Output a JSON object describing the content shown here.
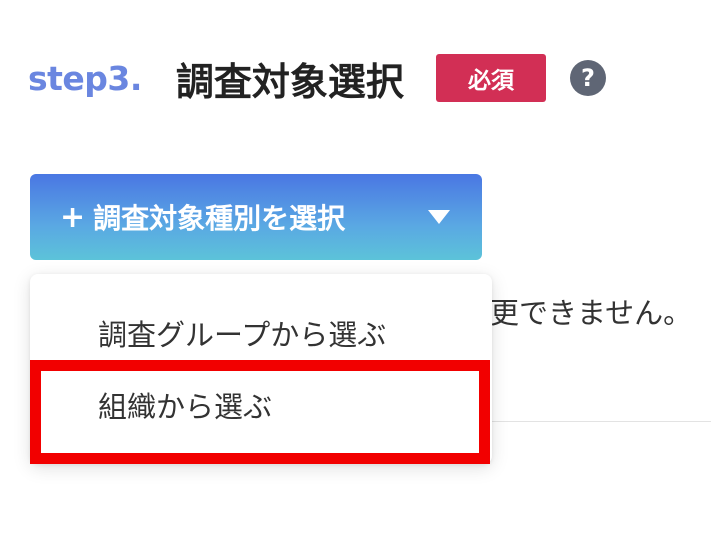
{
  "step": {
    "label": "step3.",
    "title": "調査対象選択",
    "required_badge": "必須",
    "help_icon": "?"
  },
  "select_button": {
    "plus": "+",
    "label": "調査対象種別を選択"
  },
  "background_text": "更できません。",
  "dropdown": {
    "items": [
      {
        "label": "調査グループから選ぶ"
      },
      {
        "label": "組織から選ぶ"
      }
    ]
  },
  "colors": {
    "step_label": "#6a86e0",
    "required_badge": "#d22f55",
    "help_icon": "#5f6675",
    "button_gradient_top": "#4a77e3",
    "button_gradient_bottom": "#5cc3d9",
    "highlight": "#f20000"
  }
}
